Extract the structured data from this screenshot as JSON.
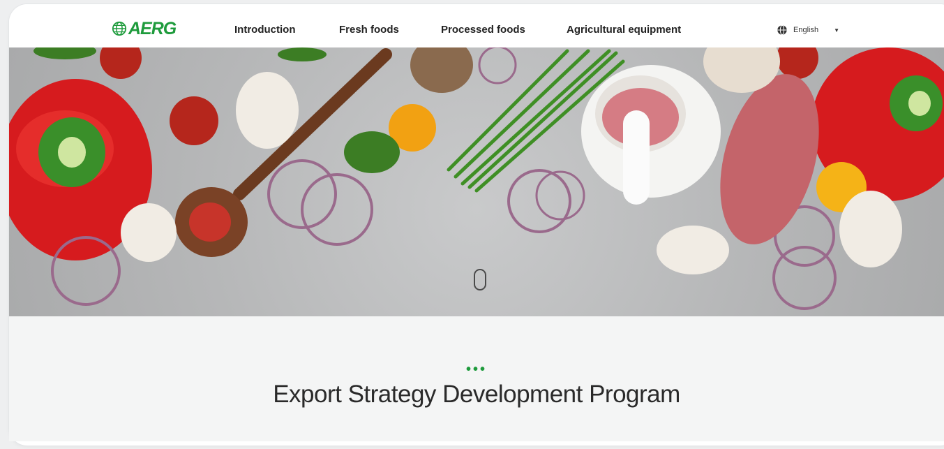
{
  "logo": {
    "text": "AERG"
  },
  "nav": {
    "items": [
      {
        "label": "Introduction"
      },
      {
        "label": "Fresh foods"
      },
      {
        "label": "Processed foods"
      },
      {
        "label": "Agricultural equipment"
      }
    ]
  },
  "language": {
    "label": "English",
    "icon": "globe-icon"
  },
  "hero": {
    "image": "vegetables-on-stone-table"
  },
  "section": {
    "dots": "•••",
    "title": "Export Strategy Development Program"
  },
  "colors": {
    "brand": "#1e9b3c",
    "text": "#2a2a2a"
  }
}
